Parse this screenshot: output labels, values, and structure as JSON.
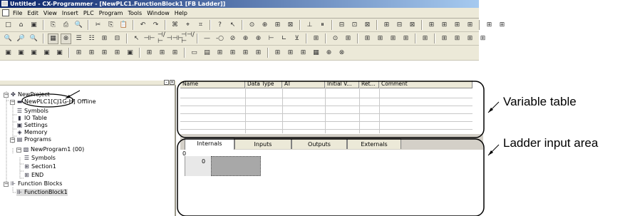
{
  "window": {
    "title": "Untitled - CX-Programmer - [NewPLC1.FunctionBlock1 [FB Ladder]]"
  },
  "menu": [
    "File",
    "Edit",
    "View",
    "Insert",
    "PLC",
    "Program",
    "Tools",
    "Window",
    "Help"
  ],
  "toolbars": {
    "row1": [
      "□",
      "⌂",
      "▣",
      "|",
      "⎘",
      "⎙",
      "🔍",
      "|",
      "✂",
      "⎘",
      "📋",
      "|",
      "↶",
      "↷",
      "|",
      "⌘",
      "⌖",
      "⌗",
      "|",
      "?",
      "↖",
      "|",
      "⊙",
      "⊕",
      "⊞",
      "⊠",
      "|",
      "⊥",
      "⏸",
      "|",
      "⊟",
      "⊡",
      "⊠",
      "|",
      "⊞",
      "⊟",
      "⊠",
      "|",
      "⊞",
      "⊞",
      "⊞",
      "⊞",
      "|",
      "⊞",
      "⊞"
    ],
    "row2": [
      "🔍",
      "🔎",
      "🔍",
      "|",
      "▦",
      "⊗",
      "☰",
      "☷",
      "⊞",
      "⊟",
      "|",
      "↖",
      "⊣⊢",
      "⊣/⊢",
      "⊣⊣⊢",
      "⊣⊣/⊢",
      "|",
      "—",
      "-○",
      "⊘",
      "⊕",
      "⊕",
      "⊢",
      "∟",
      "⊻",
      "|",
      "⊞",
      "|",
      "⊙",
      "⊞",
      "|",
      "⊞",
      "⊞",
      "⊞",
      "⊞",
      "|",
      "⊞",
      "|",
      "⊞",
      "⊞",
      "⊞",
      "⊞"
    ],
    "row3": [
      "▣",
      "▣",
      "▣",
      "▣",
      "▣",
      "|",
      "⊞",
      "⊞",
      "⊞",
      "⊞",
      "▣",
      "|",
      "⊞",
      "⊞",
      "⊞",
      "|",
      "▭",
      "▤",
      "⊞",
      "⊞",
      "⊞",
      "⊞",
      "|",
      "⊞",
      "⊞",
      "⊞",
      "▦",
      "⊕",
      "⊗"
    ]
  },
  "tree": {
    "items": [
      {
        "label": "NewProject",
        "icon": "project-icon"
      },
      {
        "label": "NewPLC1[CJ1G-H] Offline",
        "icon": "plc-icon"
      },
      {
        "label": "Symbols",
        "icon": "symbols-icon"
      },
      {
        "label": "IO Table",
        "icon": "io-table-icon"
      },
      {
        "label": "Settings",
        "icon": "settings-icon"
      },
      {
        "label": "Memory",
        "icon": "memory-icon"
      },
      {
        "label": "Programs",
        "icon": "programs-icon"
      },
      {
        "label": "NewProgram1 (00)",
        "icon": "program-icon"
      },
      {
        "label": "Symbols",
        "icon": "symbols-icon"
      },
      {
        "label": "Section1",
        "icon": "section-icon"
      },
      {
        "label": "END",
        "icon": "end-icon"
      },
      {
        "label": "Function Blocks",
        "icon": "function-blocks-icon"
      },
      {
        "label": "FunctionBlock1",
        "icon": "function-block-icon"
      }
    ]
  },
  "variable_table": {
    "columns": [
      "Name",
      "Data Type",
      "AT",
      "Initial V...",
      "Ret...",
      "Comment"
    ]
  },
  "tabs": [
    "Internals",
    "Inputs",
    "Outputs",
    "Externals"
  ],
  "ladder": {
    "rung_number": "0",
    "step_number": "0"
  },
  "annotations": {
    "variable_table_label": "Variable table",
    "ladder_input_label": "Ladder input area"
  },
  "colors": {
    "titlebar": "#0a246a",
    "chrome": "#ece9d8",
    "ladder_cursor": "#a8a8a8"
  }
}
